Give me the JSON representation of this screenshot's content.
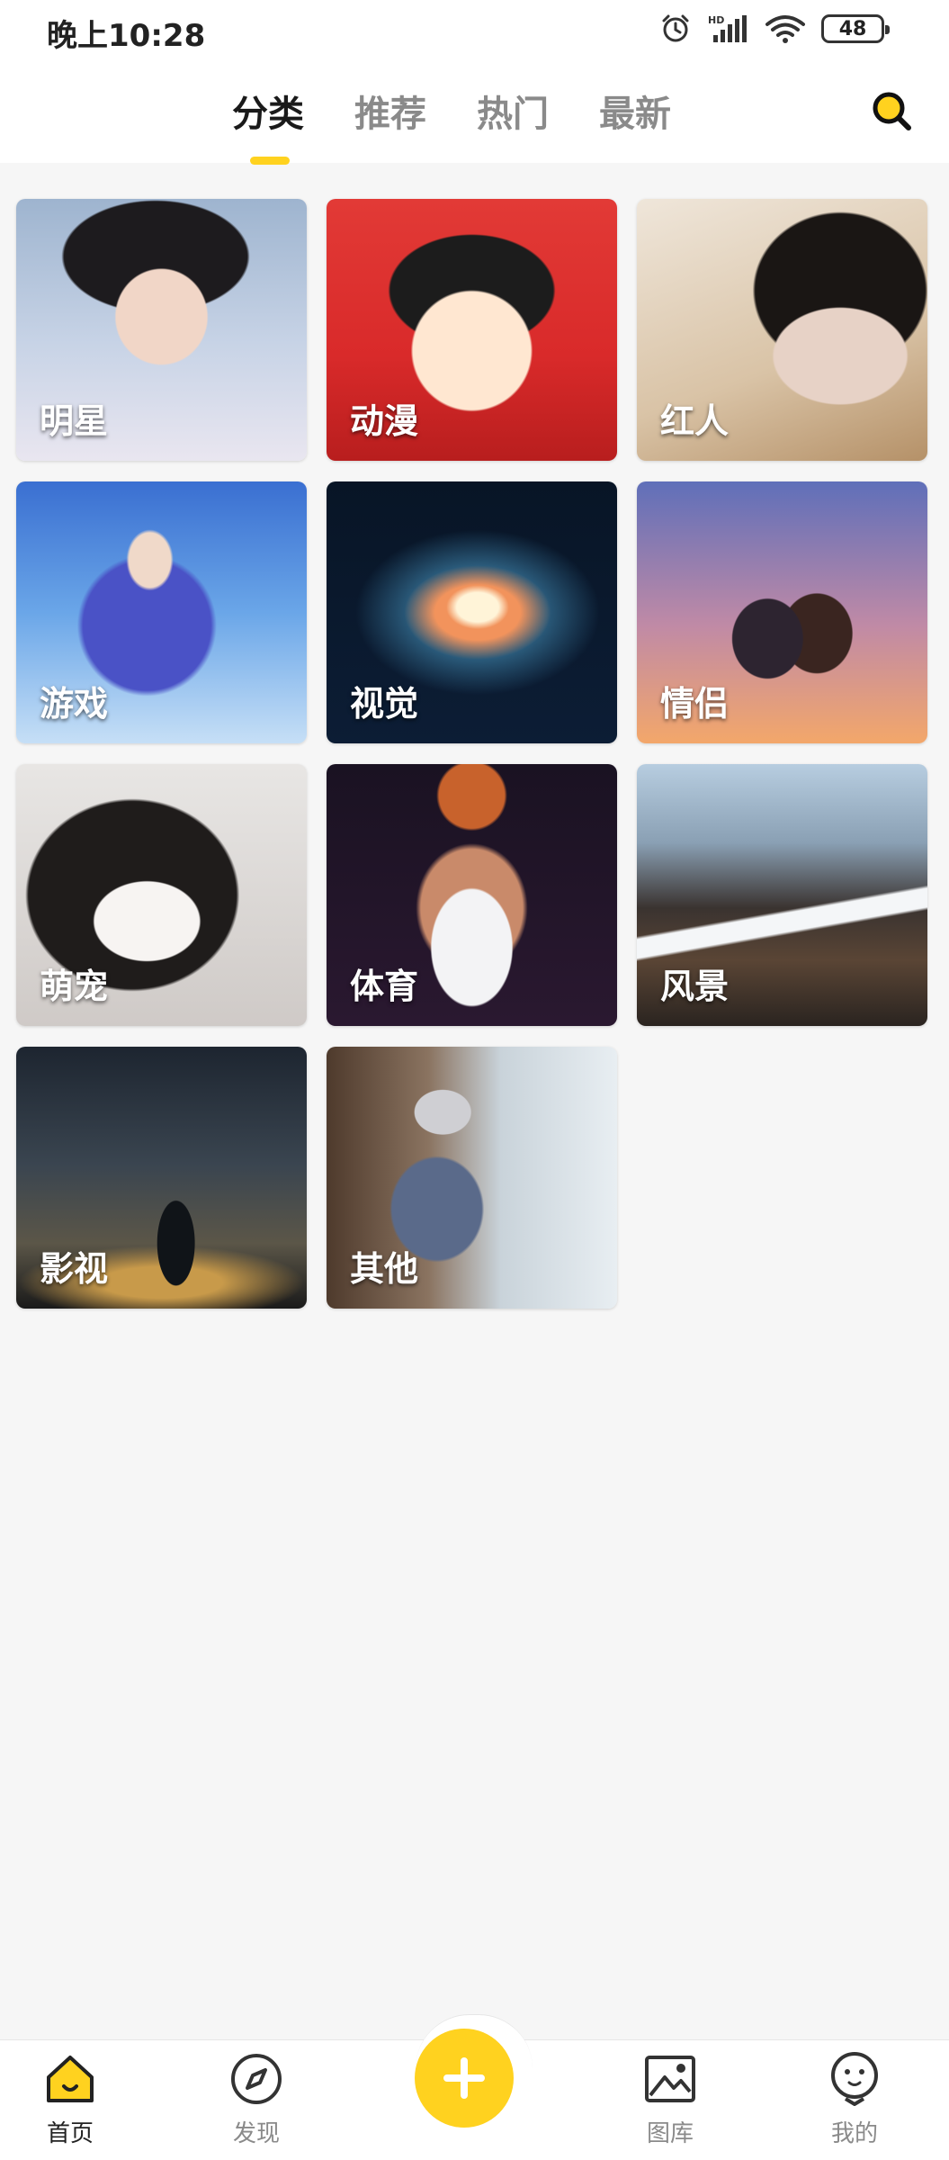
{
  "status_bar": {
    "time": "晚上10:28",
    "battery": "48",
    "icons": [
      "alarm-icon",
      "hd-signal-icon",
      "wifi-icon",
      "battery-icon"
    ]
  },
  "header": {
    "tabs": [
      {
        "label": "分类",
        "active": true
      },
      {
        "label": "推荐",
        "active": false
      },
      {
        "label": "热门",
        "active": false
      },
      {
        "label": "最新",
        "active": false
      }
    ],
    "search_icon": "search-icon"
  },
  "categories": [
    {
      "label": "明星"
    },
    {
      "label": "动漫"
    },
    {
      "label": "红人"
    },
    {
      "label": "游戏"
    },
    {
      "label": "视觉"
    },
    {
      "label": "情侣"
    },
    {
      "label": "萌宠"
    },
    {
      "label": "体育"
    },
    {
      "label": "风景"
    },
    {
      "label": "影视"
    },
    {
      "label": "其他"
    }
  ],
  "bottom_nav": {
    "items": [
      {
        "label": "首页",
        "icon": "home-icon",
        "active": true
      },
      {
        "label": "发现",
        "icon": "compass-icon",
        "active": false
      },
      {
        "label": "图库",
        "icon": "gallery-icon",
        "active": false
      },
      {
        "label": "我的",
        "icon": "profile-icon",
        "active": false
      }
    ],
    "fab_icon": "plus-icon"
  },
  "colors": {
    "accent": "#ffd21f",
    "active_text": "#1a1a1a",
    "inactive_text": "#8a8a8a",
    "background": "#f6f6f6"
  }
}
